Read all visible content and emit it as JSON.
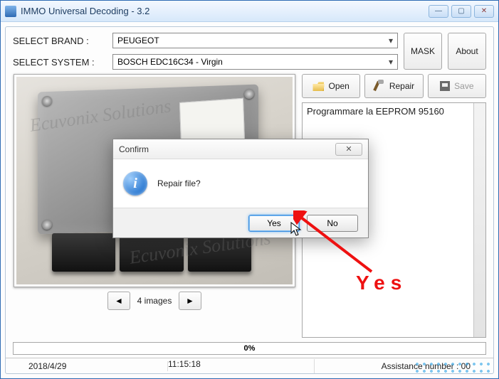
{
  "titlebar": {
    "title": "IMMO Universal Decoding - 3.2"
  },
  "form": {
    "brand_label": "SELECT BRAND :",
    "brand_value": "PEUGEOT",
    "system_label": "SELECT SYSTEM :",
    "system_value": "BOSCH EDC16C34 - Virgin",
    "mask_label": "MASK",
    "about_label": "About"
  },
  "toolbar": {
    "open_label": "Open",
    "repair_label": "Repair",
    "save_label": "Save"
  },
  "log": {
    "line1": "Programmare la EEPROM 95160"
  },
  "pager": {
    "text": "4 images"
  },
  "progress": {
    "text": "0%"
  },
  "status": {
    "date": "2018/4/29",
    "time": "11:15:18",
    "assistance": "Assistance number : 00"
  },
  "dialog": {
    "title": "Confirm",
    "message": "Repair file?",
    "yes_label": "Yes",
    "no_label": "No"
  },
  "annotation": {
    "text": "Yes"
  },
  "watermark": "Ecuvonix Solutions"
}
